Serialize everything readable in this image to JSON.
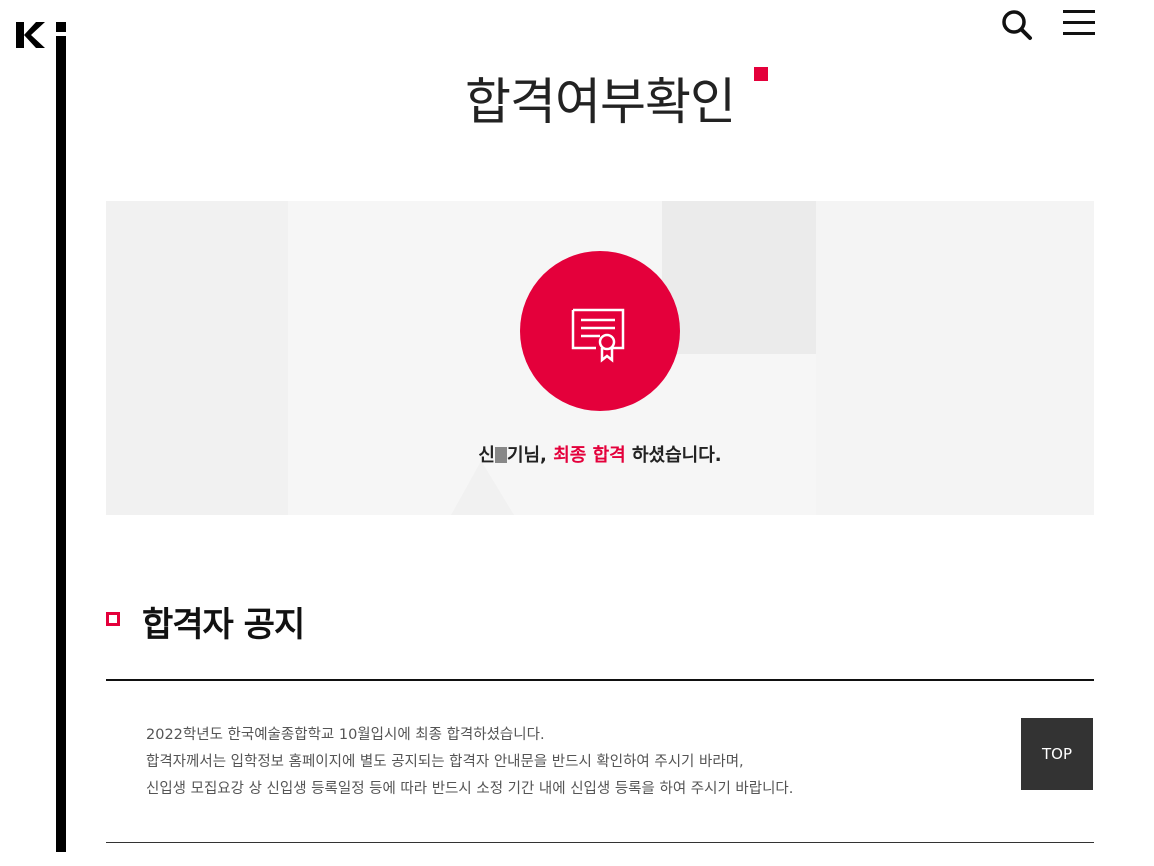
{
  "header": {
    "logo_text": "K",
    "search_icon": "search-icon",
    "menu_icon": "hamburger-menu-icon"
  },
  "page": {
    "title": "합격여부확인"
  },
  "result": {
    "icon": "certificate-icon",
    "name_prefix": "신",
    "name_suffix": "기님,",
    "highlight": "최종 합격",
    "message_end": "하셨습니다."
  },
  "notice": {
    "title": "합격자 공지",
    "lines": [
      "2022학년도 한국예술종합학교 10월입시에 최종 합격하셨습니다.",
      "합격자께서는 입학정보 홈페이지에 별도 공지되는 합격자 안내문을 반드시 확인하여 주시기 바라며,",
      "신입생 모집요강 상 신입생 등록일정 등에 따라 반드시 소정 기간 내에 신입생 등록을 하여 주시기 바랍니다."
    ]
  },
  "top_button": {
    "label": "TOP"
  },
  "colors": {
    "accent": "#e4003b",
    "panel_bg": "#f1f1f1",
    "dark_button": "#333333"
  }
}
